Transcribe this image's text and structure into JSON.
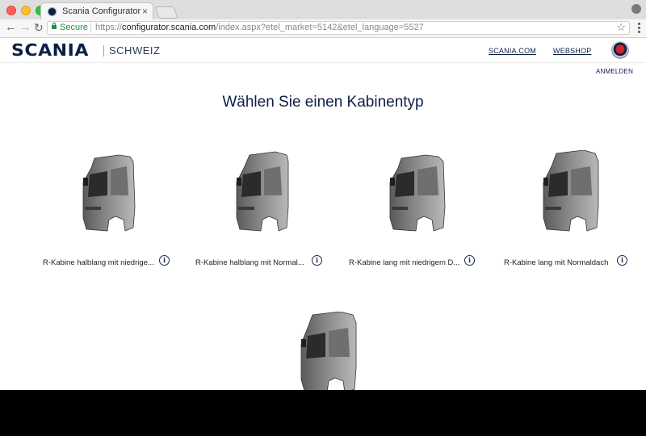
{
  "browser": {
    "tab_title": "Scania Configurator",
    "tab_close": "×",
    "secure_label": "Secure",
    "url_scheme": "https://",
    "url_host": "configurator.scania.com",
    "url_path": "/index.aspx?etel_market=5142&etel_language=5527"
  },
  "header": {
    "logo": "SCANIA",
    "market": "SCHWEIZ",
    "links": [
      "SCANIA.COM",
      "WEBSHOP"
    ],
    "login": "ANMELDEN"
  },
  "page": {
    "title": "Wählen Sie einen Kabinentyp",
    "cabs": [
      {
        "label": "R-Kabine halblang mit niedrige..."
      },
      {
        "label": "R-Kabine halblang mit Normal..."
      },
      {
        "label": "R-Kabine lang mit niedrigem D..."
      },
      {
        "label": "R-Kabine lang mit Normaldach"
      },
      {
        "label": ""
      }
    ]
  }
}
